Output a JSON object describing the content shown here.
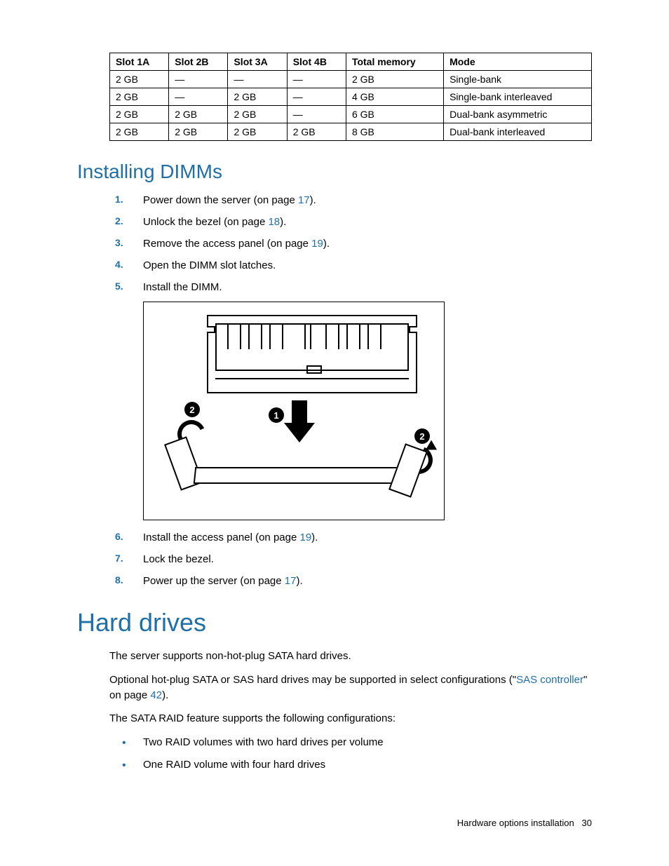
{
  "table": {
    "headers": [
      "Slot 1A",
      "Slot 2B",
      "Slot 3A",
      "Slot 4B",
      "Total memory",
      "Mode"
    ],
    "rows": [
      [
        "2 GB",
        "—",
        "—",
        "—",
        "2 GB",
        "Single-bank"
      ],
      [
        "2 GB",
        "—",
        "2 GB",
        "—",
        "4 GB",
        "Single-bank interleaved"
      ],
      [
        "2 GB",
        "2 GB",
        "2 GB",
        "—",
        "6 GB",
        "Dual-bank asymmetric"
      ],
      [
        "2 GB",
        "2 GB",
        "2 GB",
        "2 GB",
        "8 GB",
        "Dual-bank interleaved"
      ]
    ]
  },
  "section1": {
    "title": "Installing DIMMs",
    "steps": {
      "s1a": "Power down the server (on page ",
      "s1link": "17",
      "s1b": ").",
      "s2a": "Unlock the bezel (on page ",
      "s2link": "18",
      "s2b": ").",
      "s3a": "Remove the access panel (on page ",
      "s3link": "19",
      "s3b": ").",
      "s4": "Open the DIMM slot latches.",
      "s5": "Install the DIMM.",
      "s6a": "Install the access panel (on page ",
      "s6link": "19",
      "s6b": ").",
      "s7": "Lock the bezel.",
      "s8a": "Power up the server (on page ",
      "s8link": "17",
      "s8b": ")."
    }
  },
  "figure": {
    "label1": "1",
    "label2a": "2",
    "label2b": "2"
  },
  "section2": {
    "title": "Hard drives",
    "p1": "The server supports non-hot-plug SATA hard drives.",
    "p2a": "Optional hot-plug SATA or SAS hard drives may be supported in select configurations (\"",
    "p2link1": "SAS controller",
    "p2b": "\" on page ",
    "p2link2": "42",
    "p2c": ").",
    "p3": "The SATA RAID feature supports the following configurations:",
    "bullets": {
      "b1": "Two RAID volumes with two hard drives per volume",
      "b2": "One RAID volume with four hard drives"
    }
  },
  "footer": {
    "text": "Hardware options installation",
    "page": "30"
  }
}
